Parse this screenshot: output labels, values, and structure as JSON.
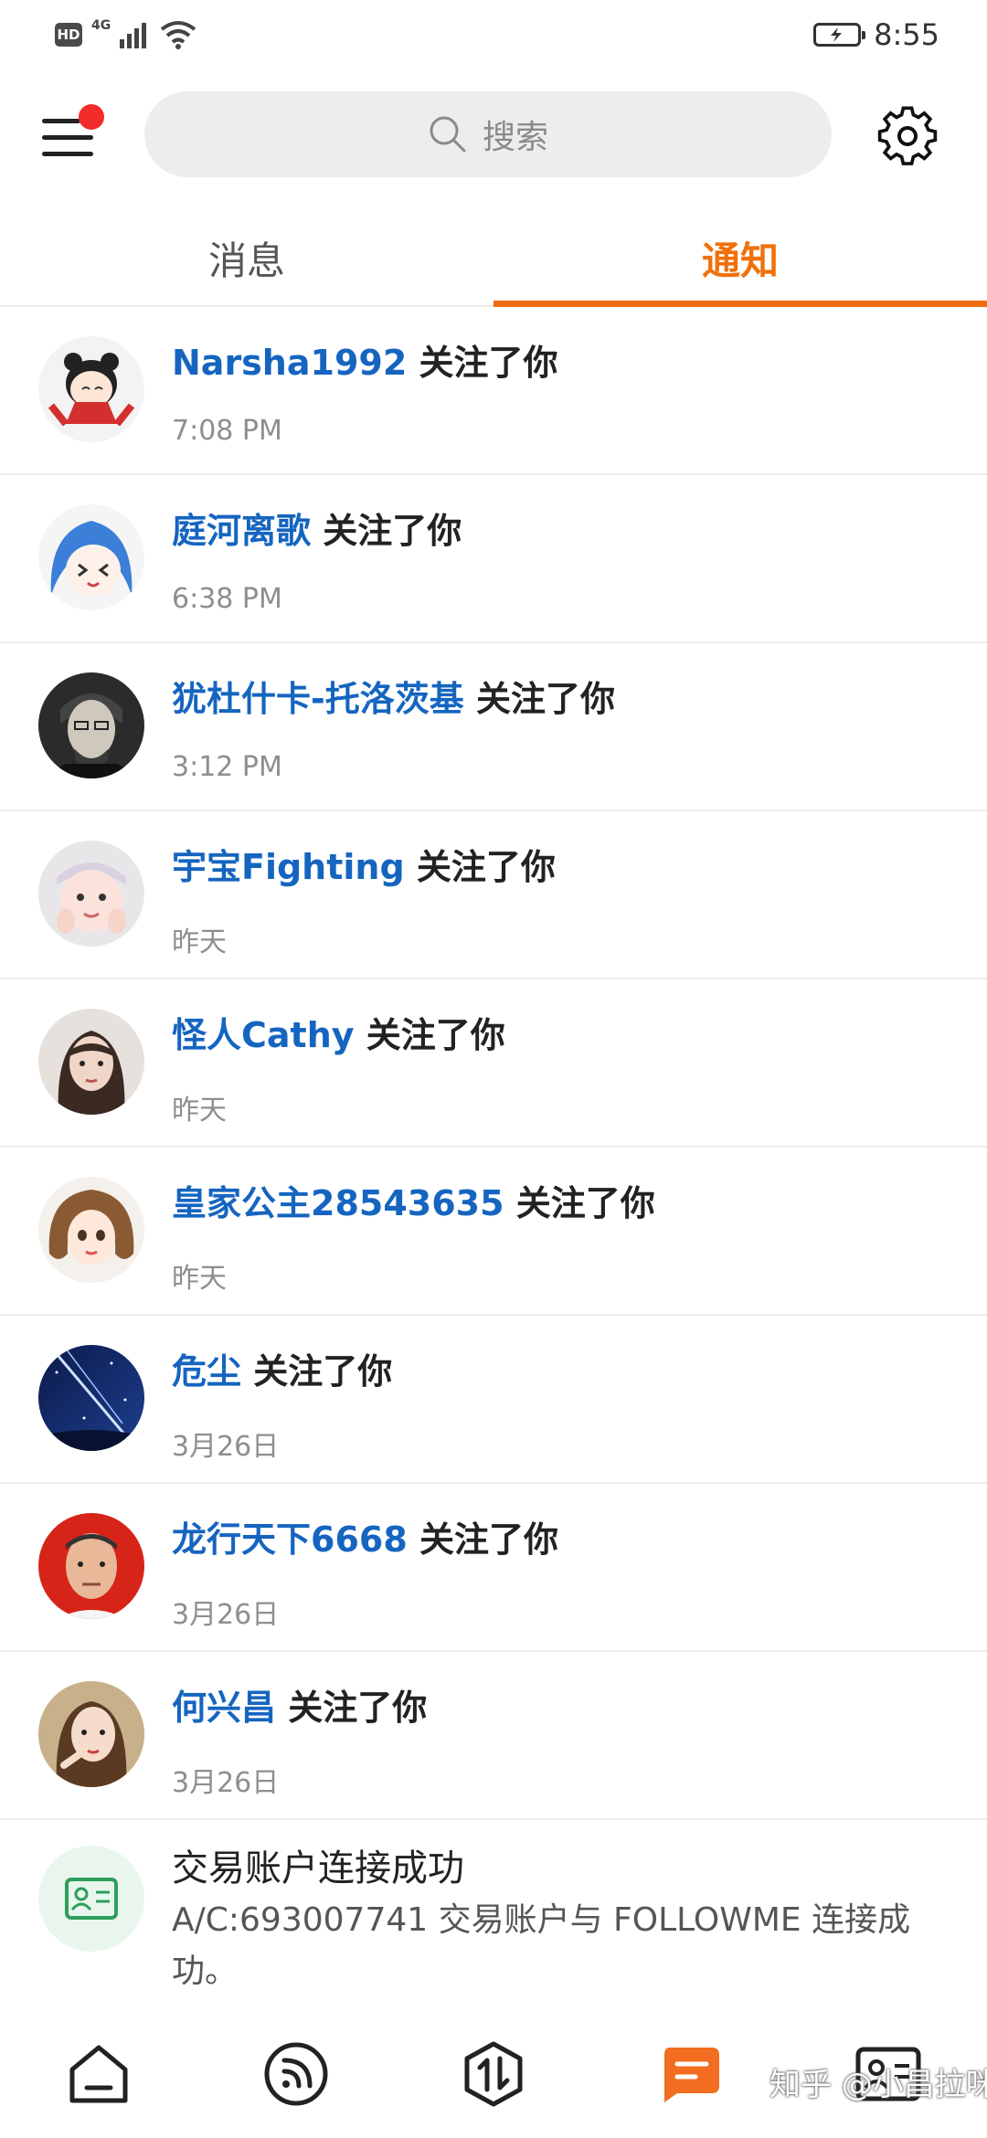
{
  "status_bar": {
    "time": "8:55",
    "hd_label": "HD",
    "network_label": "4G",
    "icons": [
      "hd-icon",
      "signal-icon",
      "wifi-icon",
      "battery-charging-icon"
    ]
  },
  "header": {
    "search_placeholder": "搜索",
    "has_unread_dot": true,
    "unread_dot_color": "#f22b2b"
  },
  "tabs": [
    {
      "label": "消息",
      "active": false
    },
    {
      "label": "通知",
      "active": true
    }
  ],
  "accent_color": "#ef6c0e",
  "link_color": "#1565c0",
  "notifications": [
    {
      "username": "Narsha1992",
      "action": "关注了你",
      "time": "7:08 PM"
    },
    {
      "username": "庭河离歌",
      "action": "关注了你",
      "time": "6:38 PM"
    },
    {
      "username": "犹杜什卡-托洛茨基",
      "action": "关注了你",
      "time": "3:12 PM"
    },
    {
      "username": "宇宝Fighting",
      "action": "关注了你",
      "time": "昨天"
    },
    {
      "username": "怪人Cathy",
      "action": "关注了你",
      "time": "昨天"
    },
    {
      "username": "皇家公主28543635",
      "action": "关注了你",
      "time": "昨天"
    },
    {
      "username": "危尘",
      "action": "关注了你",
      "time": "3月26日"
    },
    {
      "username": "龙行天下6668",
      "action": "关注了你",
      "time": "3月26日"
    },
    {
      "username": "何兴昌",
      "action": "关注了你",
      "time": "3月26日"
    }
  ],
  "system_notice": {
    "title": "交易账户连接成功",
    "description": "A/C:693007741 交易账户与 FOLLOWME 连接成功。",
    "icon": "id-card-icon"
  },
  "bottom_nav": [
    {
      "name": "home",
      "icon": "home-icon",
      "active": false
    },
    {
      "name": "feed",
      "icon": "rss-icon",
      "active": false
    },
    {
      "name": "trade",
      "icon": "trade-arrows-icon",
      "active": false
    },
    {
      "name": "messages",
      "icon": "message-icon",
      "active": true
    },
    {
      "name": "profile",
      "icon": "id-card-icon",
      "active": false
    }
  ],
  "watermark": "知乎 @小昌拉咪"
}
